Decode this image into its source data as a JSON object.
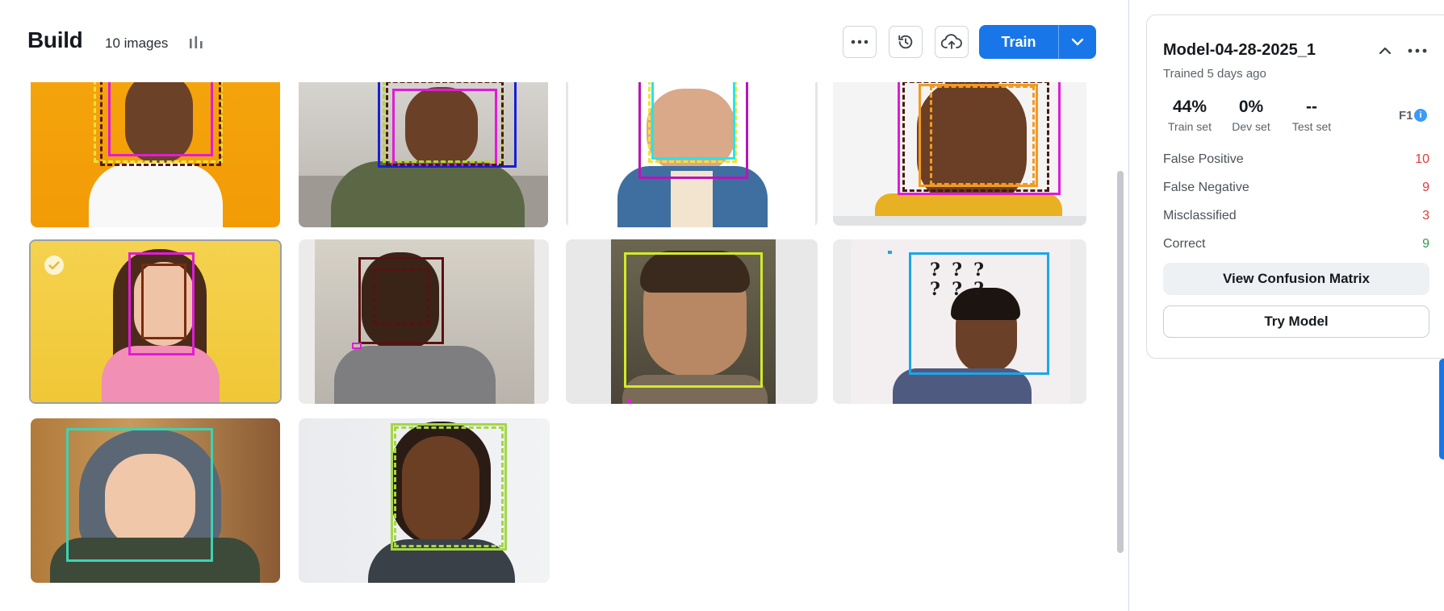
{
  "header": {
    "title": "Build",
    "image_count": "10 images",
    "train_label": "Train"
  },
  "icons": {
    "stats": "bar-chart-icon",
    "more": "more-horizontal-icon",
    "history": "history-icon",
    "upload": "cloud-upload-icon",
    "dropdown": "chevron-down-icon",
    "check": "check-circle-icon",
    "collapse": "chevron-up-icon",
    "info": "info-icon"
  },
  "colors": {
    "accent": "#1876e8",
    "negative": "#e53935",
    "positive": "#2e9b4a"
  },
  "model": {
    "name": "Model-04-28-2025_1",
    "trained": "Trained 5 days ago",
    "metrics": [
      {
        "value": "44%",
        "label": "Train set"
      },
      {
        "value": "0%",
        "label": "Dev set"
      },
      {
        "value": "--",
        "label": "Test set"
      }
    ],
    "f1_label": "F1",
    "info_glyph": "i",
    "stats": [
      {
        "label": "False Positive",
        "value": "10"
      },
      {
        "label": "False Negative",
        "value": "9"
      },
      {
        "label": "Misclassified",
        "value": "3"
      },
      {
        "label": "Correct",
        "value": "9"
      }
    ],
    "confusion_button": "View Confusion Matrix",
    "try_button": "Try Model"
  }
}
